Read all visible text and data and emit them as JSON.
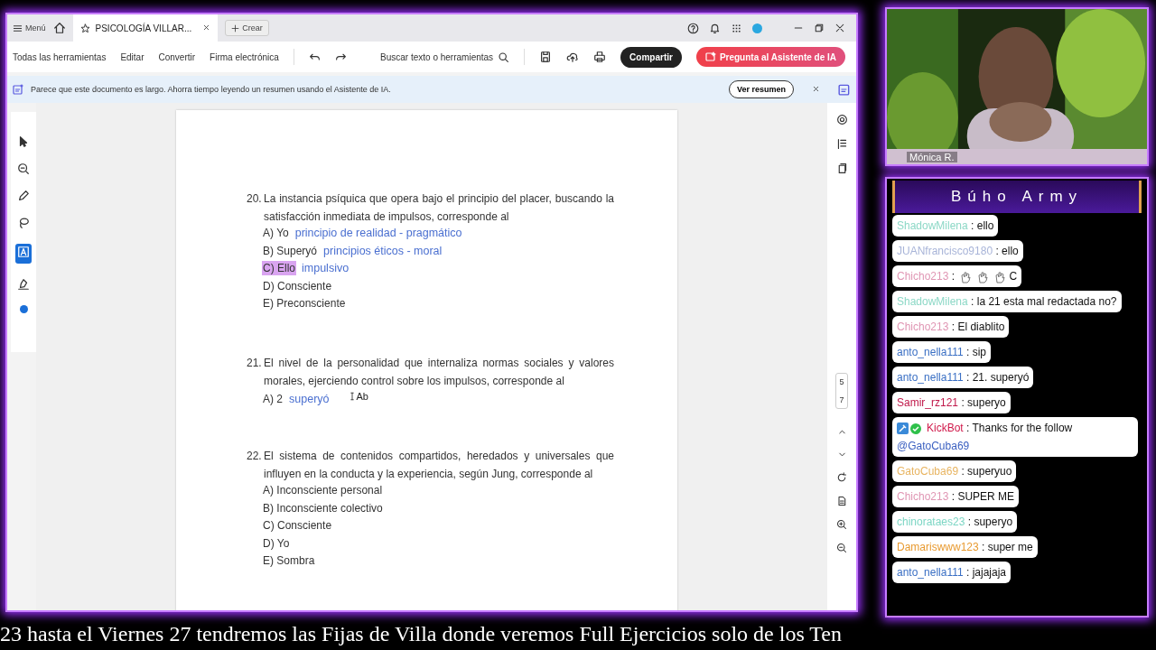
{
  "tab_bar": {
    "menu": "Menú",
    "tab": {
      "title": "PSICOLOGÍA VILLAR...",
      "selected": true
    },
    "new_tab": "Crear"
  },
  "toolbar": {
    "items": [
      "Todas las herramientas",
      "Editar",
      "Convertir",
      "Firma electrónica"
    ],
    "search": "Buscar texto o herramientas",
    "share": "Compartir",
    "ai_button": "Pregunta al Asistente de IA"
  },
  "banner": {
    "text": "Parece que este documento es largo. Ahorra tiempo leyendo un resumen usando el Asistente de IA.",
    "button": "Ver resumen"
  },
  "questions": [
    {
      "number": "20.",
      "text": "La instancia psíquica que opera bajo el principio del placer, buscando la satisfacción inmediata de impulsos, corresponde al",
      "options": [
        {
          "letter": "A)",
          "text": "Yo",
          "note": "principio de realidad - pragmático",
          "highlighted": false
        },
        {
          "letter": "B)",
          "text": "Superyó",
          "note": "principios éticos - moral",
          "highlighted": false
        },
        {
          "letter": "C)",
          "text": "Ello",
          "note": "impulsivo",
          "highlighted": true
        },
        {
          "letter": "D)",
          "text": "Consciente",
          "highlighted": false
        },
        {
          "letter": "E)",
          "text": "Preconsciente",
          "highlighted": false
        }
      ]
    },
    {
      "number": "21.",
      "text": "El nivel de la personalidad que internaliza normas sociales y valores morales, ejerciendo control sobre los impulsos, corresponde al",
      "options": [
        {
          "letter": "A)",
          "text": "2",
          "note": "superyó",
          "highlighted": false
        }
      ]
    },
    {
      "number": "22.",
      "text": "El sistema de contenidos compartidos, heredados y universales que influyen en la conducta y la experiencia, según Jung, corresponde al",
      "options": [
        {
          "letter": "A)",
          "text": "Inconsciente personal",
          "highlighted": false
        },
        {
          "letter": "B)",
          "text": "Inconsciente colectivo",
          "highlighted": false
        },
        {
          "letter": "C)",
          "text": "Consciente",
          "highlighted": false
        },
        {
          "letter": "D)",
          "text": "Yo",
          "highlighted": false
        },
        {
          "letter": "E)",
          "text": "Sombra",
          "highlighted": false
        }
      ]
    }
  ],
  "cursor_label": "Ab",
  "page_indicator": {
    "current": "5",
    "total": "7"
  },
  "webcam": {
    "name": "Mónica R."
  },
  "chat": {
    "title": "Búho Army",
    "messages": [
      {
        "user": "ShadowMilena",
        "color": "#8cd8c6",
        "sep": ":",
        "text": "ello"
      },
      {
        "user": "JUANfrancisco9180",
        "color": "#a8b4d8",
        "sep": ":",
        "text": "ello"
      },
      {
        "user": "Chicho213",
        "color": "#e096b4",
        "sep": ":",
        "emotes": [
          {
            "kind": "hand"
          },
          {
            "kind": "hand"
          },
          {
            "kind": "hand"
          }
        ],
        "text": "C"
      },
      {
        "user": "ShadowMilena",
        "color": "#8cd8c6",
        "sep": ":",
        "text": "la 21 esta mal redactada no?"
      },
      {
        "user": "Chicho213",
        "color": "#e096b4",
        "sep": ":",
        "text": "El diablito"
      },
      {
        "user": "anto_nella111",
        "color": "#3a6fc4",
        "sep": ":",
        "text": "sip"
      },
      {
        "user": "anto_nella111",
        "color": "#3a6fc4",
        "sep": ":",
        "text": "21. superyó"
      },
      {
        "user": "Samir_rz121",
        "color": "#c0184a",
        "sep": ":",
        "text": "superyo"
      },
      {
        "user": "KickBot",
        "color": "#d0184a",
        "sep": ":",
        "badges": [
          {
            "kind": "bot"
          },
          {
            "kind": "verified"
          }
        ],
        "text": "Thanks for the follow",
        "mention": "@GatoCuba69"
      },
      {
        "user": "GatoCuba69",
        "color": "#e8b460",
        "sep": ":",
        "text": "superyuo"
      },
      {
        "user": "Chicho213",
        "color": "#e096b4",
        "sep": ":",
        "text": "SUPER ME"
      },
      {
        "user": "chinorataes23",
        "color": "#7cd6c4",
        "sep": ":",
        "text": "superyo"
      },
      {
        "user": "Damariswww123",
        "color": "#e89a30",
        "sep": ":",
        "text": "super me"
      },
      {
        "user": "anto_nella111",
        "color": "#3a6fc4",
        "sep": ":",
        "text": "jajajaja"
      }
    ]
  },
  "ticker": "23 hasta el Viernes 27 tendremos las Fijas de Villa donde veremos Full Ejercicios solo de los Ten"
}
